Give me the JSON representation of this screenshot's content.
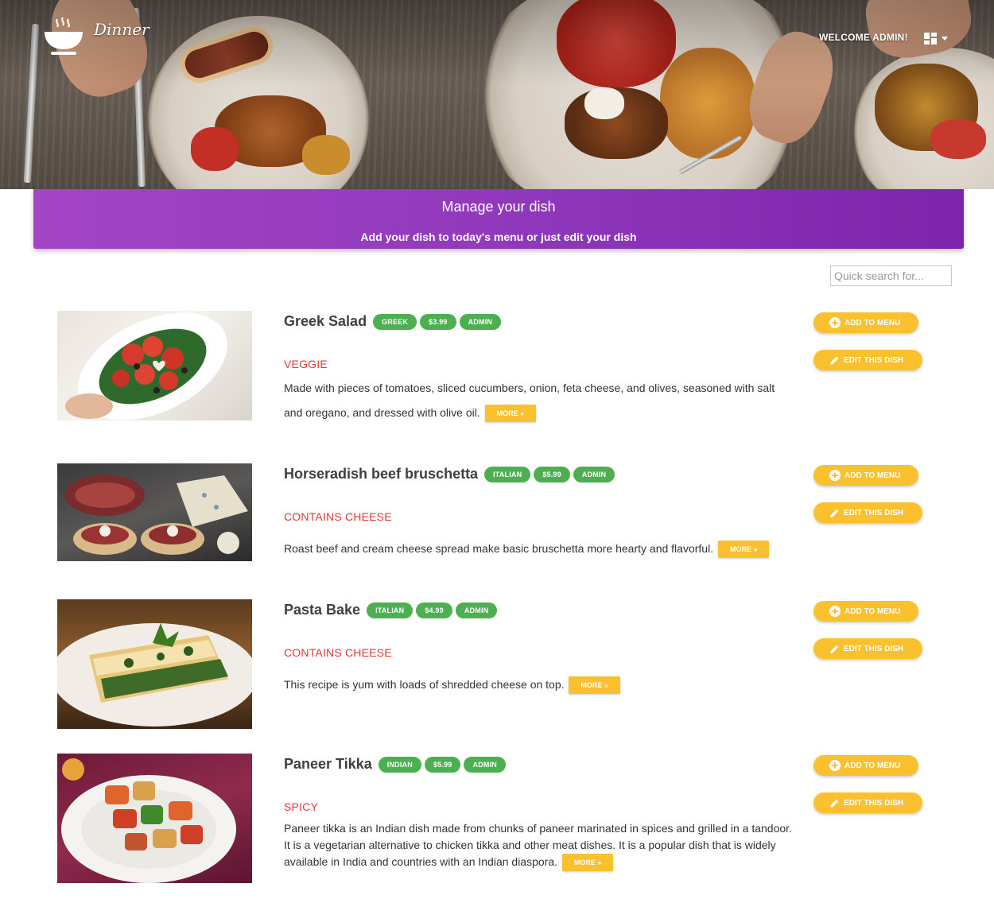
{
  "header": {
    "brand": "Dinner",
    "brand_icon": "soup-bowl-icon",
    "welcome": "WELCOME ADMIN!",
    "dashboard_icon": "dashboard-icon"
  },
  "banner": {
    "title": "Manage your dish",
    "subtitle": "Add your dish to today's menu or just edit your dish"
  },
  "search": {
    "placeholder": "Quick search for..."
  },
  "actions": {
    "add_label": "ADD TO MENU",
    "edit_label": "EDIT THIS DISH",
    "more_label": "MORE »"
  },
  "colors": {
    "accent_purple": "#9c3fc2",
    "badge_green": "#4caf50",
    "button_yellow": "#fbc02d",
    "category_red": "#e53935"
  },
  "dishes": [
    {
      "name": "Greek Salad",
      "cuisine": "GREEK",
      "price": "$3.99",
      "author": "ADMIN",
      "category": "VEGGIE",
      "description": "Made with pieces of tomatoes, sliced cucumbers, onion, feta cheese, and olives, seasoned with salt and oregano, and dressed with olive oil."
    },
    {
      "name": "Horseradish beef bruschetta",
      "cuisine": "ITALIAN",
      "price": "$5.99",
      "author": "ADMIN",
      "category": "CONTAINS CHEESE",
      "description": "Roast beef and cream cheese spread make basic bruschetta more hearty and flavorful."
    },
    {
      "name": "Pasta Bake",
      "cuisine": "ITALIAN",
      "price": "$4.99",
      "author": "ADMIN",
      "category": "CONTAINS CHEESE",
      "description": "This recipe is yum with loads of shredded cheese on top."
    },
    {
      "name": "Paneer Tikka",
      "cuisine": "INDIAN",
      "price": "$5.99",
      "author": "ADMIN",
      "category": "SPICY",
      "description": "Paneer tikka is an Indian dish made from chunks of paneer marinated in spices and grilled in a tandoor. It is a vegetarian alternative to chicken tikka and other meat dishes. It is a popular dish that is widely available in India and countries with an Indian diaspora."
    }
  ]
}
